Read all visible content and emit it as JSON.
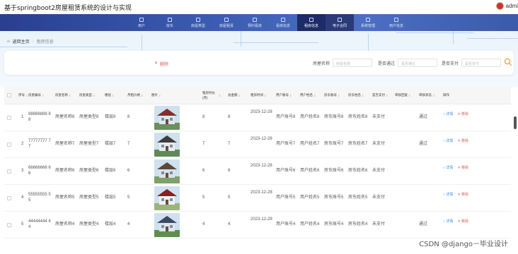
{
  "window": {
    "title": "基于springboot2房屋租赁系统的设计与实现",
    "user": "admi"
  },
  "nav": {
    "items": [
      {
        "label": "用户"
      },
      {
        "label": "房东"
      },
      {
        "label": "房屋类型"
      },
      {
        "label": "房屋租赁"
      },
      {
        "label": "预约看房"
      },
      {
        "label": "看房信息"
      },
      {
        "label": "租房信息"
      },
      {
        "label": "电子合同"
      },
      {
        "label": "系统管理"
      },
      {
        "label": "用户信息"
      }
    ],
    "active_index": 6
  },
  "breadcrumb": {
    "home": "返回主页",
    "separator": "-",
    "current": "租房信息"
  },
  "toolbar": {
    "delete_label": "删除",
    "delete_icon": "close-icon"
  },
  "search": {
    "fields": [
      {
        "label": "房屋名称",
        "placeholder": "房屋名称"
      },
      {
        "label": "是否通过",
        "placeholder": "是否通过"
      },
      {
        "label": "是否支付",
        "placeholder": "是否支付"
      }
    ]
  },
  "table": {
    "headers": [
      "序号",
      "房屋编号",
      "房屋名称",
      "房屋类型",
      "楼层",
      "月租价格",
      "图片",
      "租房时长(月)",
      "总金额",
      "租房时间",
      "用户账号",
      "用户姓名",
      "房东账号",
      "房东姓名",
      "是否支付",
      "审核回复",
      "审核状态",
      "操作"
    ],
    "rows": [
      {
        "index": "1",
        "code": "88888888 88",
        "name": "房屋名称8",
        "type": "房屋类型8",
        "floor": "楼层8",
        "price": "8",
        "duration": "8",
        "total": "8",
        "date": "2023-12-28",
        "user_account": "用户账号8",
        "user_name": "用户姓名8",
        "owner_account": "房东账号8",
        "owner_name": "房东姓名8",
        "paid": "未支付",
        "status": "通过",
        "detail": "详情",
        "remove": "移除"
      },
      {
        "index": "2",
        "code": "77777777 77",
        "name": "房屋名称7",
        "type": "房屋类型7",
        "floor": "楼层7",
        "price": "7",
        "duration": "7",
        "total": "7",
        "date": "2023-12-28",
        "user_account": "用户账号7",
        "user_name": "用户姓名7",
        "owner_account": "房东账号7",
        "owner_name": "房东姓名7",
        "paid": "未支付",
        "status": "通过",
        "detail": "详情",
        "remove": "移除"
      },
      {
        "index": "3",
        "code": "66666666 66",
        "name": "房屋名称6",
        "type": "房屋类型6",
        "floor": "楼层6",
        "price": "6",
        "duration": "6",
        "total": "6",
        "date": "2023-12-28",
        "user_account": "用户账号6",
        "user_name": "用户姓名6",
        "owner_account": "房东账号6",
        "owner_name": "房东姓名6",
        "paid": "未支付",
        "status": "",
        "detail": "详情",
        "remove": "移除"
      },
      {
        "index": "4",
        "code": "55555555 55",
        "name": "房屋名称5",
        "type": "房屋类型5",
        "floor": "楼层5",
        "price": "5",
        "duration": "5",
        "total": "5",
        "date": "2023-12-28",
        "user_account": "用户账号5",
        "user_name": "用户姓名5",
        "owner_account": "房东账号5",
        "owner_name": "房东姓名5",
        "paid": "未支付",
        "status": "",
        "detail": "详情",
        "remove": "移除"
      },
      {
        "index": "5",
        "code": "44444444 44",
        "name": "房屋名称4",
        "type": "房屋类型4",
        "floor": "楼层4",
        "price": "4",
        "duration": "4",
        "total": "4",
        "date": "2023-12-28",
        "user_account": "用户账号4",
        "user_name": "用户姓名4",
        "owner_account": "房东账号4",
        "owner_name": "房东姓名4",
        "paid": "未支付",
        "status": "通过",
        "detail": "详情",
        "remove": "移除"
      }
    ]
  },
  "watermark": "CSDN @django－毕业设计",
  "colors": {
    "nav": "#3a5bb0",
    "active": "#1d2c66",
    "danger": "#e05a5a",
    "link": "#3a8ee6"
  }
}
